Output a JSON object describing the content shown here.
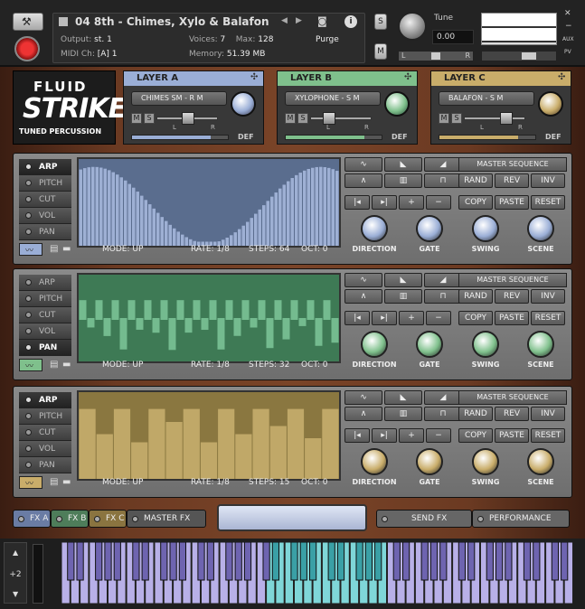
{
  "header": {
    "instrument_name": "04 8th - Chimes, Xylo & Balafon",
    "output_label": "Output:",
    "output_value": "st. 1",
    "voices_label": "Voices:",
    "voices_value": "7",
    "max_label": "Max:",
    "max_value": "128",
    "purge_label": "Purge",
    "midi_label": "MIDI Ch:",
    "midi_value": "[A]  1",
    "memory_label": "Memory:",
    "memory_value": "51.39 MB",
    "tune_label": "Tune",
    "tune_value": "0.00",
    "s_label": "S",
    "m_label": "M",
    "aux_label": "AUX",
    "pv_label": "PV",
    "l_label": "L",
    "r_label": "R"
  },
  "brand": {
    "fluid": "FLUID",
    "strike": "STRIKE",
    "subtitle": "TUNED PERCUSSION"
  },
  "layers": [
    {
      "title": "LAYER A",
      "preset": "CHIMES SM - R M",
      "m": "M",
      "s": "S",
      "l": "L",
      "r": "R",
      "def": "DEF",
      "color": "#9aaed6",
      "meter_fill": 0.82
    },
    {
      "title": "LAYER B",
      "preset": "XYLOPHONE - S M",
      "m": "M",
      "s": "S",
      "l": "L",
      "r": "R",
      "def": "DEF",
      "color": "#7fc08c",
      "meter_fill": 0.82
    },
    {
      "title": "LAYER C",
      "preset": "BALAFON - S M",
      "m": "M",
      "s": "S",
      "l": "L",
      "r": "R",
      "def": "DEF",
      "color": "#c9ad6a",
      "meter_fill": 0.82
    }
  ],
  "tabs": [
    "ARP",
    "PITCH",
    "CUT",
    "VOL",
    "PAN"
  ],
  "seq_buttons": {
    "master_sequence": "MASTER SEQUENCE",
    "rand": "RAND",
    "rev": "REV",
    "inv": "INV",
    "copy": "COPY",
    "paste": "PASTE",
    "reset": "RESET",
    "plus": "+",
    "minus": "−",
    "shift_left": "|◂",
    "shift_right": "▸|"
  },
  "knob_labels": [
    "DIRECTION",
    "GATE",
    "SWING",
    "SCENE"
  ],
  "rows": [
    {
      "active_tab": "ARP",
      "mode": "MODE: UP",
      "rate": "RATE: 1/8",
      "steps": "STEPS: 64",
      "oct": "OCT:  0",
      "color": "#9aaed6",
      "grid_bg": "#5a6d8e",
      "bar_color": "#aabce0"
    },
    {
      "active_tab": "PAN",
      "mode": "MODE: UP",
      "rate": "RATE: 1/8",
      "steps": "STEPS: 32",
      "oct": "OCT:  0",
      "color": "#7fc08c",
      "grid_bg": "#3e7a55",
      "bar_color": "#7ec79a"
    },
    {
      "active_tab": "ARP",
      "mode": "MODE: UP",
      "rate": "RATE: 1/8",
      "steps": "STEPS: 15",
      "oct": "OCT:  0",
      "color": "#c9ad6a",
      "grid_bg": "#8a7740",
      "bar_color": "#c9b070"
    }
  ],
  "footer": {
    "fx_a": "FX A",
    "fx_b": "FX B",
    "fx_c": "FX C",
    "master_fx": "MASTER FX",
    "send_fx": "SEND FX",
    "performance": "PERFORMANCE"
  },
  "keyboard": {
    "octave": "+2",
    "highlight_color": "#7fd6d8",
    "key_color": "#b8b0e8"
  }
}
